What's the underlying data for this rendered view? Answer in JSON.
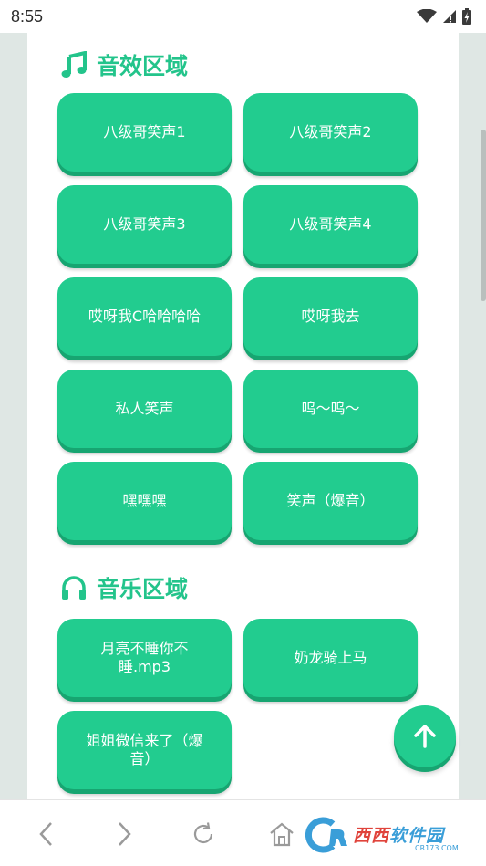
{
  "status_bar": {
    "time": "8:55"
  },
  "sound_effects": {
    "title": "音效区域",
    "icon": "music-note-icon",
    "buttons": [
      "八级哥笑声1",
      "八级哥笑声2",
      "八级哥笑声3",
      "八级哥笑声4",
      "哎呀我C哈哈哈哈",
      "哎呀我去",
      "私人笑声",
      "呜～呜～",
      "嘿嘿嘿",
      "笑声（爆音）"
    ]
  },
  "music": {
    "title": "音乐区域",
    "icon": "headphones-icon",
    "buttons": [
      "月亮不睡你不睡.mp3",
      "奶龙骑上马",
      "姐姐微信来了（爆音）"
    ]
  },
  "back_to_top": {
    "icon": "arrow-up-icon"
  },
  "browser_bar": {
    "watermark_brand_red": "西西",
    "watermark_brand_blue": "软件园",
    "watermark_url": "CR173.COM"
  },
  "colors": {
    "accent": "#22cc8f",
    "accent_shadow": "#17a571",
    "title": "#23c48b"
  }
}
